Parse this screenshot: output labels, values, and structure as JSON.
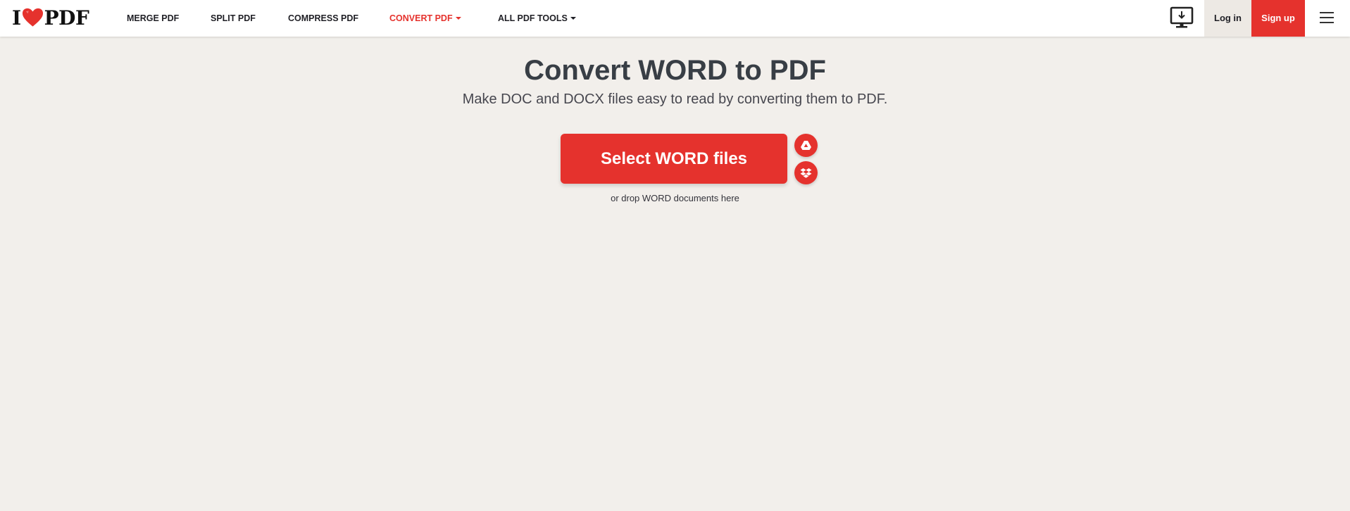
{
  "brand": {
    "logo_left": "I",
    "logo_right": "PDF",
    "logo_icon": "heart-icon",
    "accent_color": "#e5322d"
  },
  "nav": {
    "merge": "MERGE PDF",
    "split": "SPLIT PDF",
    "compress": "COMPRESS PDF",
    "convert": "CONVERT PDF",
    "all_tools": "ALL PDF TOOLS"
  },
  "header_actions": {
    "desktop_icon": "desktop-download-icon",
    "login": "Log in",
    "signup": "Sign up",
    "menu_icon": "hamburger-menu-icon"
  },
  "hero": {
    "title": "Convert WORD to PDF",
    "subtitle": "Make DOC and DOCX files easy to read by converting them to PDF.",
    "select_button": "Select WORD files",
    "drop_hint": "or drop WORD documents here",
    "cloud_icons": [
      "google-drive-icon",
      "dropbox-icon"
    ]
  },
  "colors": {
    "background": "#f2efeb",
    "header_bg": "#ffffff",
    "login_bg": "#ede9e4",
    "title_color": "#383e45"
  }
}
